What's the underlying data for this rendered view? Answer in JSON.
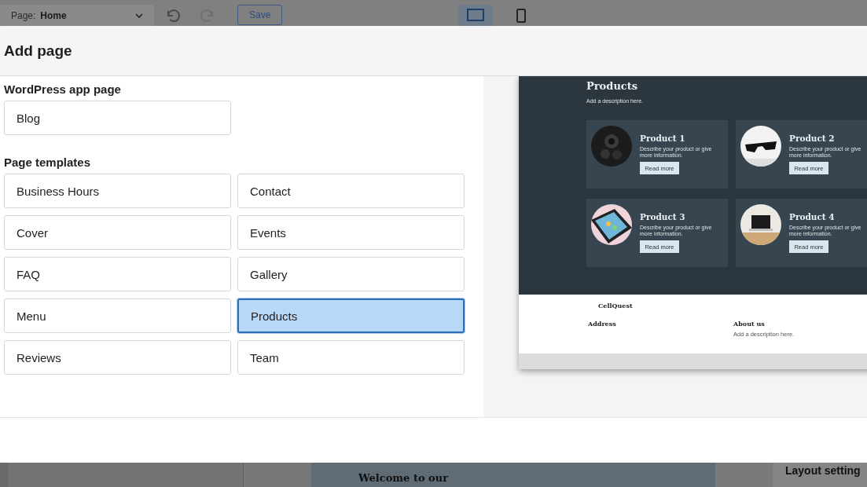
{
  "background": {
    "page_select": {
      "label": "Page:",
      "value": "Home"
    },
    "save": "Save",
    "canvas_heading": "Welcome to our",
    "panel_title": "Layout setting"
  },
  "dialog": {
    "title": "Add page",
    "sections": [
      {
        "heading": "WordPress app page",
        "options": [
          {
            "label": "Blog",
            "selected": false
          }
        ]
      },
      {
        "heading": "Page templates",
        "options": [
          {
            "label": "Business Hours",
            "selected": false
          },
          {
            "label": "Contact",
            "selected": false
          },
          {
            "label": "Cover",
            "selected": false
          },
          {
            "label": "Events",
            "selected": false
          },
          {
            "label": "FAQ",
            "selected": false
          },
          {
            "label": "Gallery",
            "selected": false
          },
          {
            "label": "Menu",
            "selected": false
          },
          {
            "label": "Products",
            "selected": true
          },
          {
            "label": "Reviews",
            "selected": false
          },
          {
            "label": "Team",
            "selected": false
          }
        ]
      }
    ],
    "preview": {
      "heading": "Products",
      "description": "Add a description here.",
      "products": [
        {
          "name": "Product 1",
          "text": "Describe your product or give more information.",
          "button": "Read more"
        },
        {
          "name": "Product 2",
          "text": "Describe your product or give more information.",
          "button": "Read more"
        },
        {
          "name": "Product 3",
          "text": "Describe your product or give more information.",
          "button": "Read more"
        },
        {
          "name": "Product 4",
          "text": "Describe your product or give more information.",
          "button": "Read more"
        }
      ],
      "footer": {
        "brand": "CellQuest",
        "columns": [
          {
            "heading": "Address"
          },
          {
            "heading": "About us",
            "text": "Add a description here."
          }
        ]
      }
    }
  }
}
